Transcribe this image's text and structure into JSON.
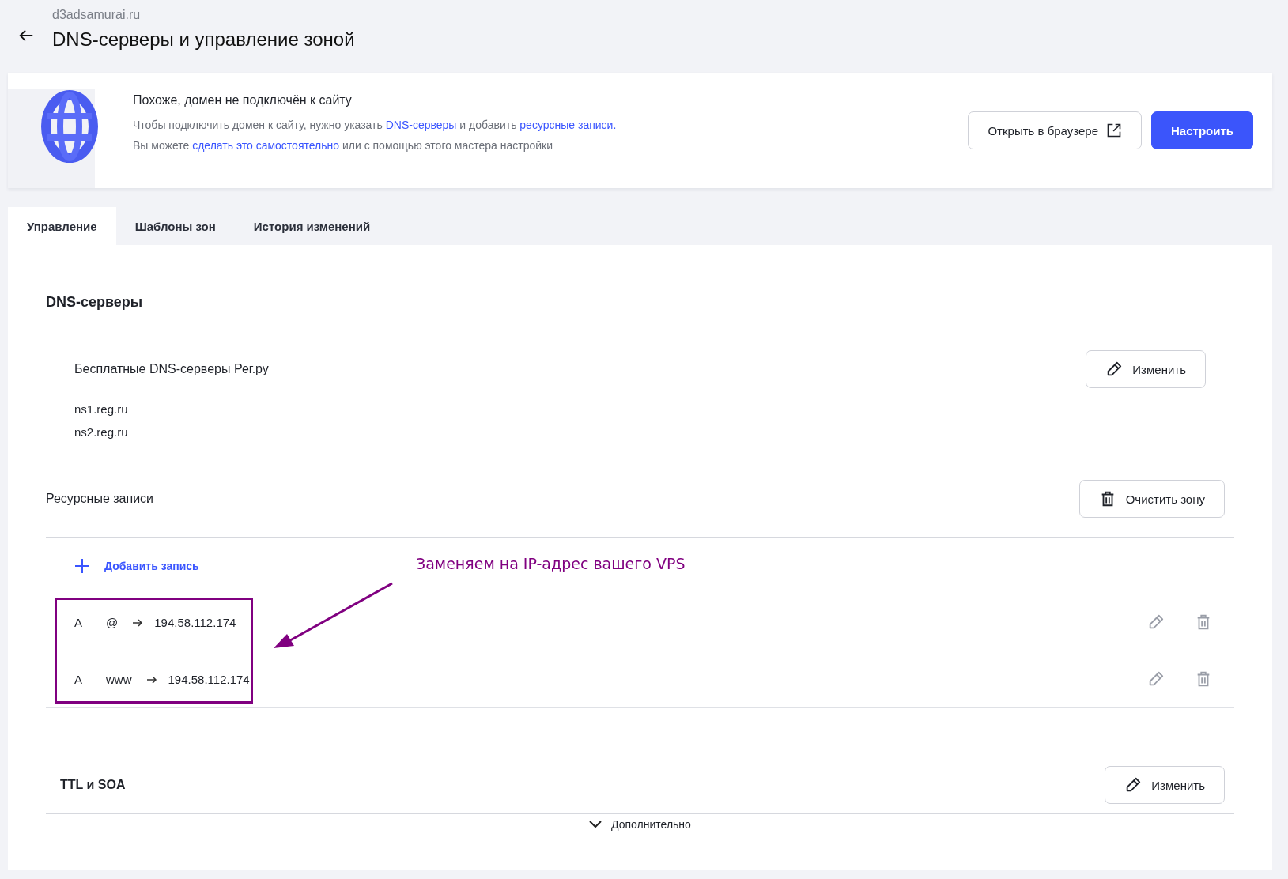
{
  "header": {
    "domain": "d3adsamurai.ru",
    "title": "DNS-серверы и управление зоной"
  },
  "banner": {
    "heading": "Похоже, домен не подключён к сайту",
    "lines": [
      [
        {
          "text": "Чтобы подключить домен к сайту, нужно указать ",
          "link": false
        },
        {
          "text": "DNS-серверы",
          "link": true
        },
        {
          "text": " и добавить ",
          "link": false
        },
        {
          "text": "ресурсные записи.",
          "link": true
        }
      ],
      [
        {
          "text": "Вы можете ",
          "link": false
        },
        {
          "text": "сделать это самостоятельно",
          "link": true
        },
        {
          "text": " или с помощью этого мастера настройки",
          "link": false
        }
      ]
    ],
    "buttons": [
      {
        "label": "Открыть в браузере",
        "kind": "outline"
      },
      {
        "label": "Настроить",
        "kind": "primary"
      }
    ]
  },
  "tabs": [
    {
      "label": "Управление",
      "selected": true
    },
    {
      "label": "Шаблоны зон",
      "selected": false
    },
    {
      "label": "История изменений",
      "selected": false
    }
  ],
  "dns_servers": {
    "heading": "DNS-серверы",
    "provider": "Бесплатные DNS-серверы Рег.ру",
    "edit_button": "Изменить",
    "servers": [
      "ns1.reg.ru",
      "ns2.reg.ru"
    ]
  },
  "resource_records": {
    "heading": "Ресурсные записи",
    "clear_button": "Очистить зону",
    "add_record": "Добавить запись",
    "records": [
      {
        "type": "A",
        "name": "@",
        "value": "194.58.112.174"
      },
      {
        "type": "A",
        "name": "www",
        "value": "194.58.112.174"
      }
    ]
  },
  "annotation": {
    "text": "Заменяем на IP-адрес вашего VPS"
  },
  "ttl_soa": {
    "heading": "TTL и SOA",
    "edit_button": "Изменить",
    "more": "Дополнительно"
  }
}
